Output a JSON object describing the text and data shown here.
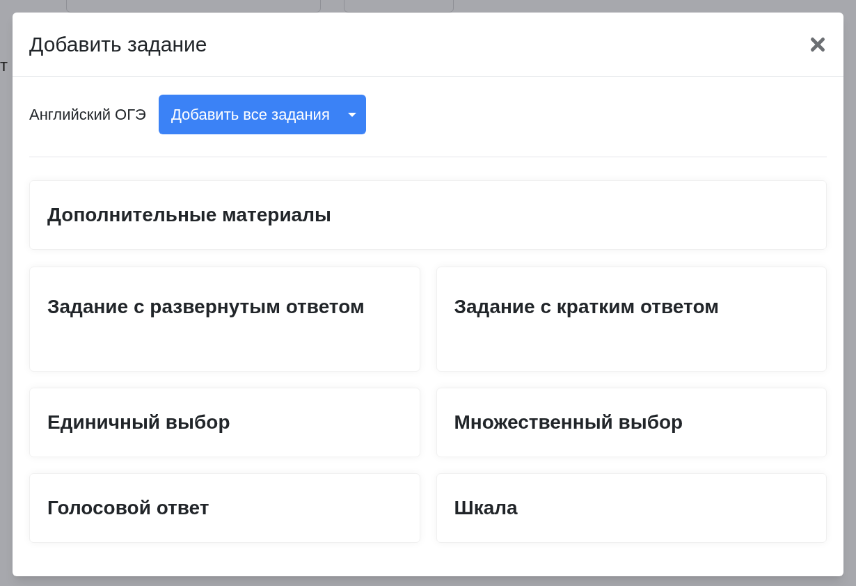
{
  "backdrop": {
    "fragment": "т"
  },
  "dialog": {
    "title": "Добавить задание",
    "subject": "Английский ОГЭ",
    "add_all_button": "Добавить все задания",
    "full_width_card": {
      "title": "Дополнительные материалы"
    },
    "cards": [
      {
        "title": "Задание с развернутым ответом"
      },
      {
        "title": "Задание с кратким ответом"
      },
      {
        "title": "Единичный выбор"
      },
      {
        "title": "Множественный выбор"
      },
      {
        "title": "Голосовой ответ"
      },
      {
        "title": "Шкала"
      }
    ]
  }
}
